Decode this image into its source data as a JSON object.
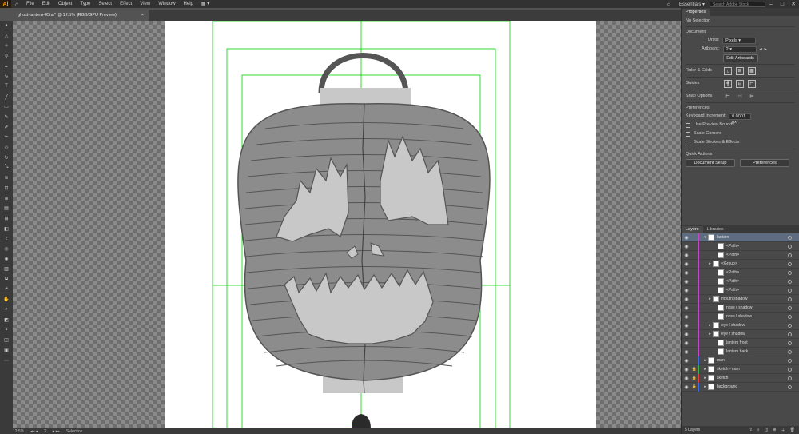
{
  "app": {
    "logo": "Ai",
    "home_icon": "home-icon"
  },
  "menus": [
    "File",
    "Edit",
    "Object",
    "Type",
    "Select",
    "Effect",
    "View",
    "Window",
    "Help"
  ],
  "workspace": "Essentials",
  "search": {
    "placeholder": "Search Adobe Stock"
  },
  "tab": {
    "title": "ghost-lantern-05.ai* @ 12.5% (RGB/GPU Preview)",
    "close": "×"
  },
  "status": {
    "zoom": "12.5%",
    "artboard": "2",
    "mode": "Selection"
  },
  "properties": {
    "tabs": [
      "Properties"
    ],
    "selection": "No Selection",
    "document": {
      "header": "Document",
      "units_label": "Units:",
      "units": "Pixels",
      "artboard_label": "Artboard:",
      "artboard": "2",
      "edit_artboards": "Edit Artboards"
    },
    "ruler_grid": "Ruler & Grids",
    "guides": "Guides",
    "snap": "Snap Options",
    "preferences": {
      "header": "Preferences",
      "keyboard_label": "Keyboard Increment:",
      "keyboard_value": "0.0001 px",
      "use_preview_bounds": "Use Preview Bounds",
      "scale_corners": "Scale Corners",
      "scale_strokes": "Scale Strokes & Effects"
    },
    "quick_actions": {
      "header": "Quick Actions",
      "document_setup": "Document Setup",
      "preferences": "Preferences"
    }
  },
  "layers_panel": {
    "tabs": [
      "Layers",
      "Libraries"
    ],
    "count": "5 Layers",
    "rows": [
      {
        "name": "lantern",
        "indent": 0,
        "color": "#c34ac6",
        "expanded": true,
        "selected": true
      },
      {
        "name": "<Path>",
        "indent": 2,
        "color": "#c34ac6"
      },
      {
        "name": "<Path>",
        "indent": 2,
        "color": "#c34ac6"
      },
      {
        "name": "<Group>",
        "indent": 1,
        "color": "#c34ac6",
        "arrow": true
      },
      {
        "name": "<Path>",
        "indent": 2,
        "color": "#c34ac6"
      },
      {
        "name": "<Path>",
        "indent": 2,
        "color": "#c34ac6"
      },
      {
        "name": "<Path>",
        "indent": 2,
        "color": "#c34ac6"
      },
      {
        "name": "mouth shadow",
        "indent": 1,
        "color": "#c34ac6",
        "arrow": true
      },
      {
        "name": "nose r shadow",
        "indent": 2,
        "color": "#c34ac6"
      },
      {
        "name": "nose l shadow",
        "indent": 2,
        "color": "#c34ac6"
      },
      {
        "name": "eye l shadow",
        "indent": 1,
        "color": "#c34ac6",
        "arrow": true
      },
      {
        "name": "eye r shadow",
        "indent": 1,
        "color": "#c34ac6",
        "arrow": true
      },
      {
        "name": "lantern front",
        "indent": 2,
        "color": "#c34ac6"
      },
      {
        "name": "lantern back",
        "indent": 2,
        "color": "#c34ac6"
      },
      {
        "name": "man",
        "indent": 0,
        "color": "#3f6de0",
        "arrow": true
      },
      {
        "name": "sketch - man",
        "indent": 0,
        "color": "#3fb24c",
        "arrow": true,
        "locked": true
      },
      {
        "name": "sketch",
        "indent": 0,
        "color": "#e04040",
        "arrow": true,
        "locked": true
      },
      {
        "name": "background",
        "indent": 0,
        "color": "#3f6de0",
        "arrow": true,
        "locked": true
      }
    ]
  },
  "colors": {
    "accent": "#ff9a00",
    "guide": "#00d000",
    "lantern": "#8c8c8c",
    "lantern_dark": "#5a5a5a",
    "lantern_light": "#c8c8c8"
  }
}
